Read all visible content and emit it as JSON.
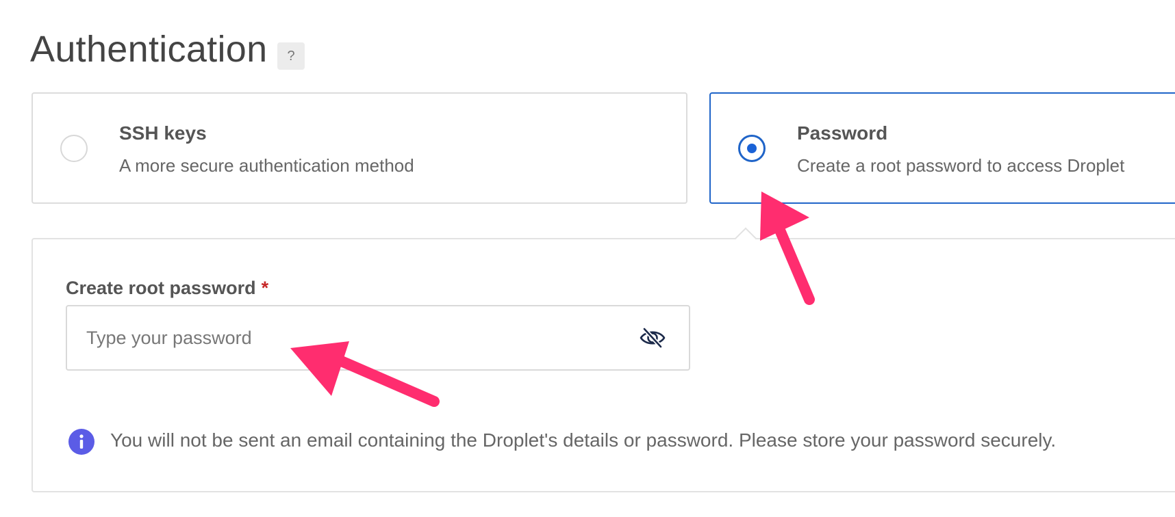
{
  "section": {
    "title": "Authentication",
    "help_label": "?"
  },
  "options": {
    "ssh": {
      "title": "SSH keys",
      "description": "A more secure authentication method",
      "selected": false
    },
    "password": {
      "title": "Password",
      "description": "Create a root password to access Droplet",
      "selected": true
    }
  },
  "password_panel": {
    "label": "Create root password",
    "required_marker": "*",
    "input_placeholder": "Type your password",
    "input_value": "",
    "toggle_icon": "eye-slash-icon",
    "info_icon": "info-icon",
    "info_text": "You will not be sent an email containing the Droplet's details or password. Please store your password securely."
  },
  "annotations": {
    "arrow_color": "#ff2d6f",
    "arrow_icon": "annotation-arrow"
  },
  "colors": {
    "accent": "#1f64c8",
    "radio_dot": "#1a62d6",
    "info_icon": "#5b5ce6",
    "required": "#c62828"
  }
}
